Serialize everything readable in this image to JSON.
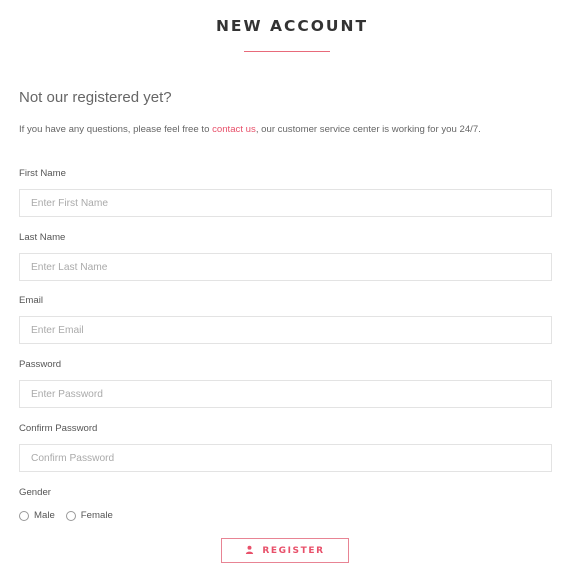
{
  "page": {
    "title": "NEW ACCOUNT",
    "subtitle": "Not our registered yet?",
    "info_prefix": "If you have any questions, please feel free to ",
    "info_link": "contact us",
    "info_suffix": ", our customer service center is working for you 24/7."
  },
  "form": {
    "first_name": {
      "label": "First Name",
      "placeholder": "Enter First Name"
    },
    "last_name": {
      "label": "Last Name",
      "placeholder": "Enter Last Name"
    },
    "email": {
      "label": "Email",
      "placeholder": "Enter Email"
    },
    "password": {
      "label": "Password",
      "placeholder": "Enter Password"
    },
    "confirm_password": {
      "label": "Confirm Password",
      "placeholder": "Confirm Password"
    },
    "gender": {
      "label": "Gender",
      "options": [
        "Male",
        "Female"
      ]
    },
    "register_label": "REGISTER"
  },
  "icons": {
    "register": "user-icon"
  },
  "colors": {
    "accent": "#e8506a",
    "field_border": "#e3e3e3"
  }
}
